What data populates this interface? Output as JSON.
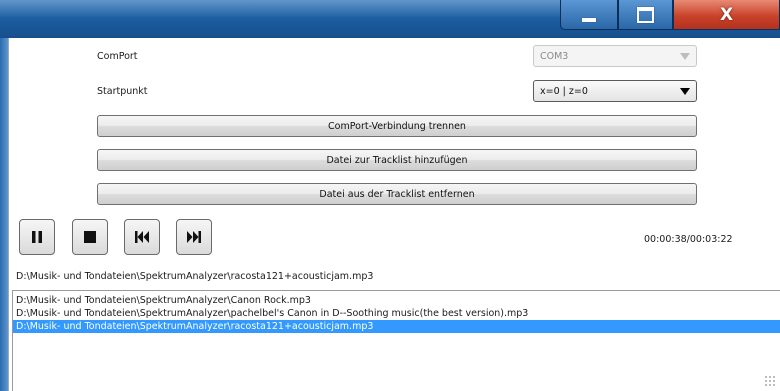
{
  "window": {
    "controls": {
      "minimize_icon": "minimize-icon",
      "maximize_icon": "maximize-icon",
      "close_glyph": "X"
    }
  },
  "settings": {
    "comport_label": "ComPort",
    "comport_value": "COM3",
    "startpunkt_label": "Startpunkt",
    "startpunkt_value": "x=0 | z=0"
  },
  "actions": {
    "disconnect_label": "ComPort-Verbindung trennen",
    "add_label": "Datei zur Tracklist hinzufügen",
    "remove_label": "Datei aus der Tracklist entfernen"
  },
  "player": {
    "buttons": [
      "pause-icon",
      "stop-icon",
      "previous-icon",
      "next-icon"
    ],
    "time": "00:00:38/00:03:22",
    "current_path": "D:\\Musik- und Tondateien\\SpektrumAnalyzer\\racosta121+acousticjam.mp3"
  },
  "tracklist": {
    "items": [
      "D:\\Musik- und Tondateien\\SpektrumAnalyzer\\Canon Rock.mp3",
      "D:\\Musik- und Tondateien\\SpektrumAnalyzer\\pachelbel's Canon in D--Soothing music(the best version).mp3",
      "D:\\Musik- und Tondateien\\SpektrumAnalyzer\\racosta121+acousticjam.mp3"
    ],
    "selected_index": 2
  },
  "colors": {
    "titlebar": "#1f63a6",
    "close_button": "#c9432b",
    "selection": "#3399ff"
  }
}
